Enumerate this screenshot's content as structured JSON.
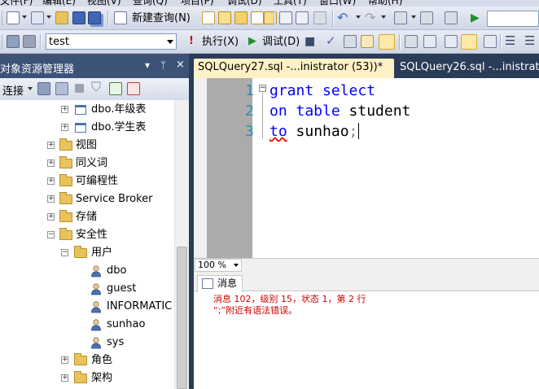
{
  "menu": [
    "文件(F)",
    "编辑(E)",
    "视图(V)",
    "查询(Q)",
    "项目(P)",
    "调试(D)",
    "工具(T)",
    "窗口(W)",
    "帮助(H)"
  ],
  "toolbar1": {
    "new_query_label": "新建查询(N)"
  },
  "toolbar2": {
    "database": "test",
    "execute_label": "执行(X)",
    "debug_label": "调试(D)"
  },
  "object_explorer": {
    "title": "对象资源管理器",
    "pin_glyph": "▾ ⊓ ×",
    "connect_label": "连接",
    "tree": [
      {
        "label": "dbo.年级表",
        "icon": "table-icon",
        "expander": "+"
      },
      {
        "label": "dbo.学生表",
        "icon": "table-icon",
        "expander": "+"
      },
      {
        "label": "视图",
        "icon": "folder-icon",
        "expander": "+"
      },
      {
        "label": "同义词",
        "icon": "folder-icon",
        "expander": "+"
      },
      {
        "label": "可编程性",
        "icon": "folder-icon",
        "expander": "+"
      },
      {
        "label": "Service Broker",
        "icon": "folder-icon",
        "expander": "+"
      },
      {
        "label": "存储",
        "icon": "folder-icon",
        "expander": "+"
      },
      {
        "label": "安全性",
        "icon": "folder-icon",
        "expander": "−"
      },
      {
        "label": "用户",
        "icon": "folder-icon",
        "expander": "−"
      },
      {
        "label": "dbo",
        "icon": "user-icon",
        "expander": ""
      },
      {
        "label": "guest",
        "icon": "user-icon",
        "expander": ""
      },
      {
        "label": "INFORMATIC",
        "icon": "user-icon",
        "expander": ""
      },
      {
        "label": "sunhao",
        "icon": "user-icon",
        "expander": ""
      },
      {
        "label": "sys",
        "icon": "user-icon",
        "expander": ""
      },
      {
        "label": "角色",
        "icon": "folder-icon",
        "expander": "+"
      },
      {
        "label": "架构",
        "icon": "folder-icon",
        "expander": "+"
      }
    ]
  },
  "tabs": [
    {
      "label": "SQLQuery27.sql -...inistrator (53))*"
    },
    {
      "label": "SQLQuery26.sql -...inistrator"
    }
  ],
  "editor": {
    "line_numbers": [
      "1",
      "2",
      "3"
    ],
    "lines": [
      {
        "kw": "grant select",
        "rest": ""
      },
      {
        "kw": "on table",
        "rest": " student"
      },
      {
        "kw": "to",
        "rest": " sunhao",
        "punc": ";"
      }
    ]
  },
  "zoom": "100 %",
  "results": {
    "tab_label": "消息",
    "messages": [
      "消息 102，级别 15，状态 1，第 2 行",
      "“;”附近有语法错误。"
    ]
  },
  "colors": {
    "keyword": "#0000ff",
    "line_number": "#2b91af",
    "error_text": "#d00000",
    "active_tab": "#fff1c6",
    "chrome": "#2b3c59"
  }
}
